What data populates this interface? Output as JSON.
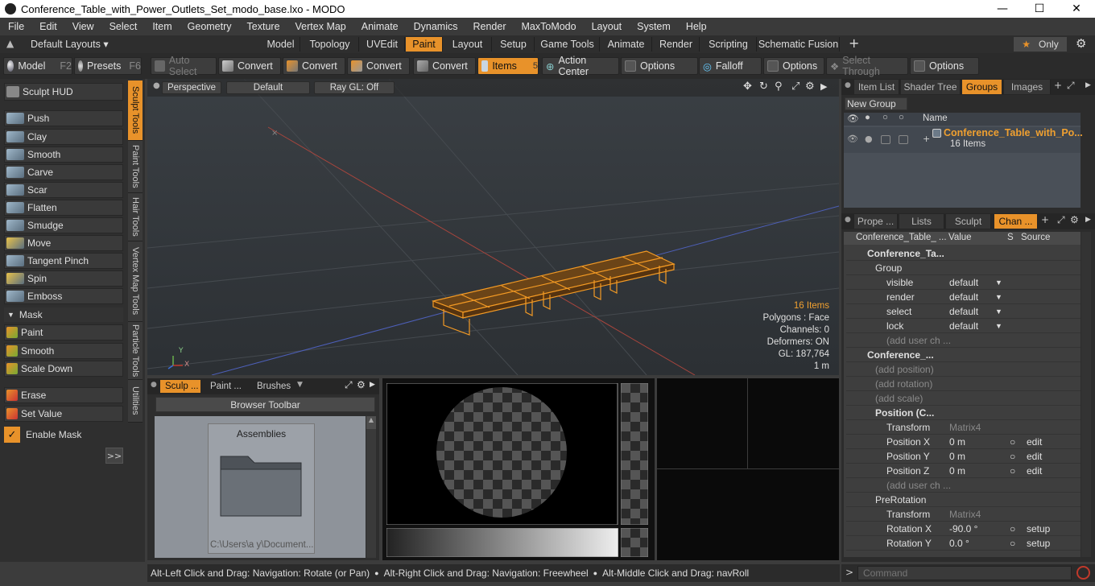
{
  "window": {
    "title": "Conference_Table_with_Power_Outlets_Set_modo_base.lxo - MODO"
  },
  "menu": [
    "File",
    "Edit",
    "View",
    "Select",
    "Item",
    "Geometry",
    "Texture",
    "Vertex Map",
    "Animate",
    "Dynamics",
    "Render",
    "MaxToModo",
    "Layout",
    "System",
    "Help"
  ],
  "layouts": {
    "label": "Default Layouts ▾",
    "tabs": [
      "Model",
      "Topology",
      "UVEdit",
      "Paint",
      "Layout",
      "Setup",
      "Game Tools",
      "Animate",
      "Render",
      "Scripting",
      "Schematic Fusion"
    ],
    "only": "Only",
    "plus": "+"
  },
  "toolbar": {
    "model": "Model",
    "model_key": "F2",
    "presets": "Presets",
    "presets_key": "F6",
    "auto_select": "Auto Select",
    "convert": "Convert",
    "items": "Items",
    "items_key": "5",
    "action_center": "Action Center",
    "options": "Options",
    "falloff": "Falloff",
    "select_through": "Select Through"
  },
  "left": {
    "sculpt_hud": "Sculpt HUD",
    "tools": [
      "Push",
      "Clay",
      "Smooth",
      "Carve",
      "Scar",
      "Flatten",
      "Smudge",
      "Move",
      "Tangent Pinch",
      "Spin",
      "Emboss"
    ],
    "mask_header": "Mask",
    "mask_tools": [
      "Paint",
      "Smooth",
      "Scale Down"
    ],
    "erase": "Erase",
    "set_value": "Set Value",
    "enable_mask": "Enable Mask",
    "more": ">>"
  },
  "vtabs": [
    "Sculpt Tools",
    "Paint Tools",
    "Hair Tools",
    "Vertex Map Tools",
    "Particle Tools",
    "Utilities"
  ],
  "viewport": {
    "perspective": "Perspective",
    "default": "Default",
    "raygl": "Ray GL: Off",
    "axis_y": "Y",
    "axis_x": "X",
    "stats": {
      "items": "16 Items",
      "polygons": "Polygons : Face",
      "channels": "Channels: 0",
      "deformers": "Deformers: ON",
      "gl": "GL: 187,764",
      "scale": "1 m"
    }
  },
  "browser": {
    "tabs": [
      "Sculp ...",
      "Paint ...",
      "Brushes"
    ],
    "toolbar": "Browser Toolbar",
    "folder": "Assemblies",
    "path": "C:\\Users\\a y\\Document..."
  },
  "right": {
    "tabs_top": [
      "Item List",
      "Shader Tree",
      "Groups",
      "Images"
    ],
    "new_group": "New Group",
    "name_col": "Name",
    "group_name": "Conference_Table_with_Po...",
    "group_count": "16 Items",
    "tabs_mid": [
      "Prope ...",
      "Lists",
      "Sculpt",
      "Chan ..."
    ],
    "ch_headers": [
      "Conference_Table_ ...",
      "Value",
      "S",
      "Source"
    ],
    "channels": [
      {
        "label": "Conference_Ta...",
        "indent": 1,
        "value": "",
        "src": ""
      },
      {
        "label": "Group",
        "indent": 2,
        "value": "",
        "src": ""
      },
      {
        "label": "visible",
        "indent": 3,
        "value": "default",
        "src": ""
      },
      {
        "label": "render",
        "indent": 3,
        "value": "default",
        "src": ""
      },
      {
        "label": "select",
        "indent": 3,
        "value": "default",
        "src": ""
      },
      {
        "label": "lock",
        "indent": 3,
        "value": "default",
        "src": ""
      },
      {
        "label": "(add user ch ...",
        "indent": 3,
        "value": "",
        "src": ""
      },
      {
        "label": "Conference_...",
        "indent": 1,
        "value": "",
        "src": ""
      },
      {
        "label": "(add position)",
        "indent": 2,
        "value": "",
        "src": ""
      },
      {
        "label": "(add rotation)",
        "indent": 2,
        "value": "",
        "src": ""
      },
      {
        "label": "(add scale)",
        "indent": 2,
        "value": "",
        "src": ""
      },
      {
        "label": "Position (C...",
        "indent": 2,
        "value": "",
        "src": ""
      },
      {
        "label": "Transform",
        "indent": 3,
        "value": "Matrix4",
        "src": ""
      },
      {
        "label": "Position X",
        "indent": 3,
        "value": "0 m",
        "src": "edit"
      },
      {
        "label": "Position Y",
        "indent": 3,
        "value": "0 m",
        "src": "edit"
      },
      {
        "label": "Position Z",
        "indent": 3,
        "value": "0 m",
        "src": "edit"
      },
      {
        "label": "(add user ch ...",
        "indent": 3,
        "value": "",
        "src": ""
      },
      {
        "label": "PreRotation",
        "indent": 2,
        "value": "",
        "src": ""
      },
      {
        "label": "Transform",
        "indent": 3,
        "value": "Matrix4",
        "src": ""
      },
      {
        "label": "Rotation X",
        "indent": 3,
        "value": "-90.0 °",
        "src": "setup"
      },
      {
        "label": "Rotation Y",
        "indent": 3,
        "value": "0.0 °",
        "src": "setup"
      }
    ]
  },
  "status": {
    "text1": "Alt-Left Click and Drag: Navigation: Rotate (or Pan)",
    "text2": "Alt-Right Click and Drag: Navigation: Freewheel",
    "text3": "Alt-Middle Click and Drag: navRoll"
  },
  "command": {
    "placeholder": "Command"
  },
  "colors": {
    "accent": "#e8922a",
    "selection": "#f0a030"
  }
}
